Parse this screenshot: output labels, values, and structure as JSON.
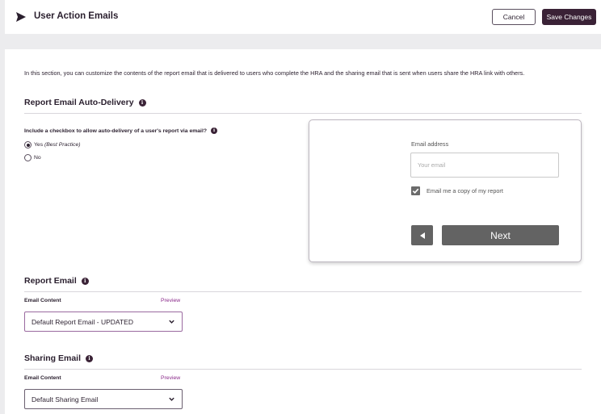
{
  "header": {
    "title": "User Action Emails",
    "cancel_label": "Cancel",
    "save_label": "Save Changes",
    "logo_icon": "send-icon"
  },
  "intro": "In this section, you can customize the contents of the report email that is delivered to users who complete the HRA and the sharing email that is sent when users share the HRA link with others.",
  "auto_delivery": {
    "title": "Report Email Auto-Delivery",
    "question": "Include a checkbox to allow auto-delivery of a user's report via email?",
    "options": [
      {
        "label": "Yes",
        "note": "(Best Practice)",
        "selected": true
      },
      {
        "label": "No",
        "note": "",
        "selected": false
      }
    ]
  },
  "preview_card": {
    "email_label": "Email address",
    "email_placeholder": "Your email",
    "checkbox_label": "Email me a copy of my report",
    "checkbox_checked": true,
    "next_label": "Next",
    "back_icon": "triangle-left-icon"
  },
  "report_email": {
    "title": "Report Email",
    "content_label": "Email Content",
    "preview_label": "Preview",
    "selected": "Default Report Email - UPDATED"
  },
  "sharing_email": {
    "title": "Sharing Email",
    "content_label": "Email Content",
    "preview_label": "Preview",
    "selected": "Default Sharing Email"
  },
  "colors": {
    "brand": "#3a2236",
    "link": "#8a2a8a",
    "page_bg": "#ececee"
  }
}
